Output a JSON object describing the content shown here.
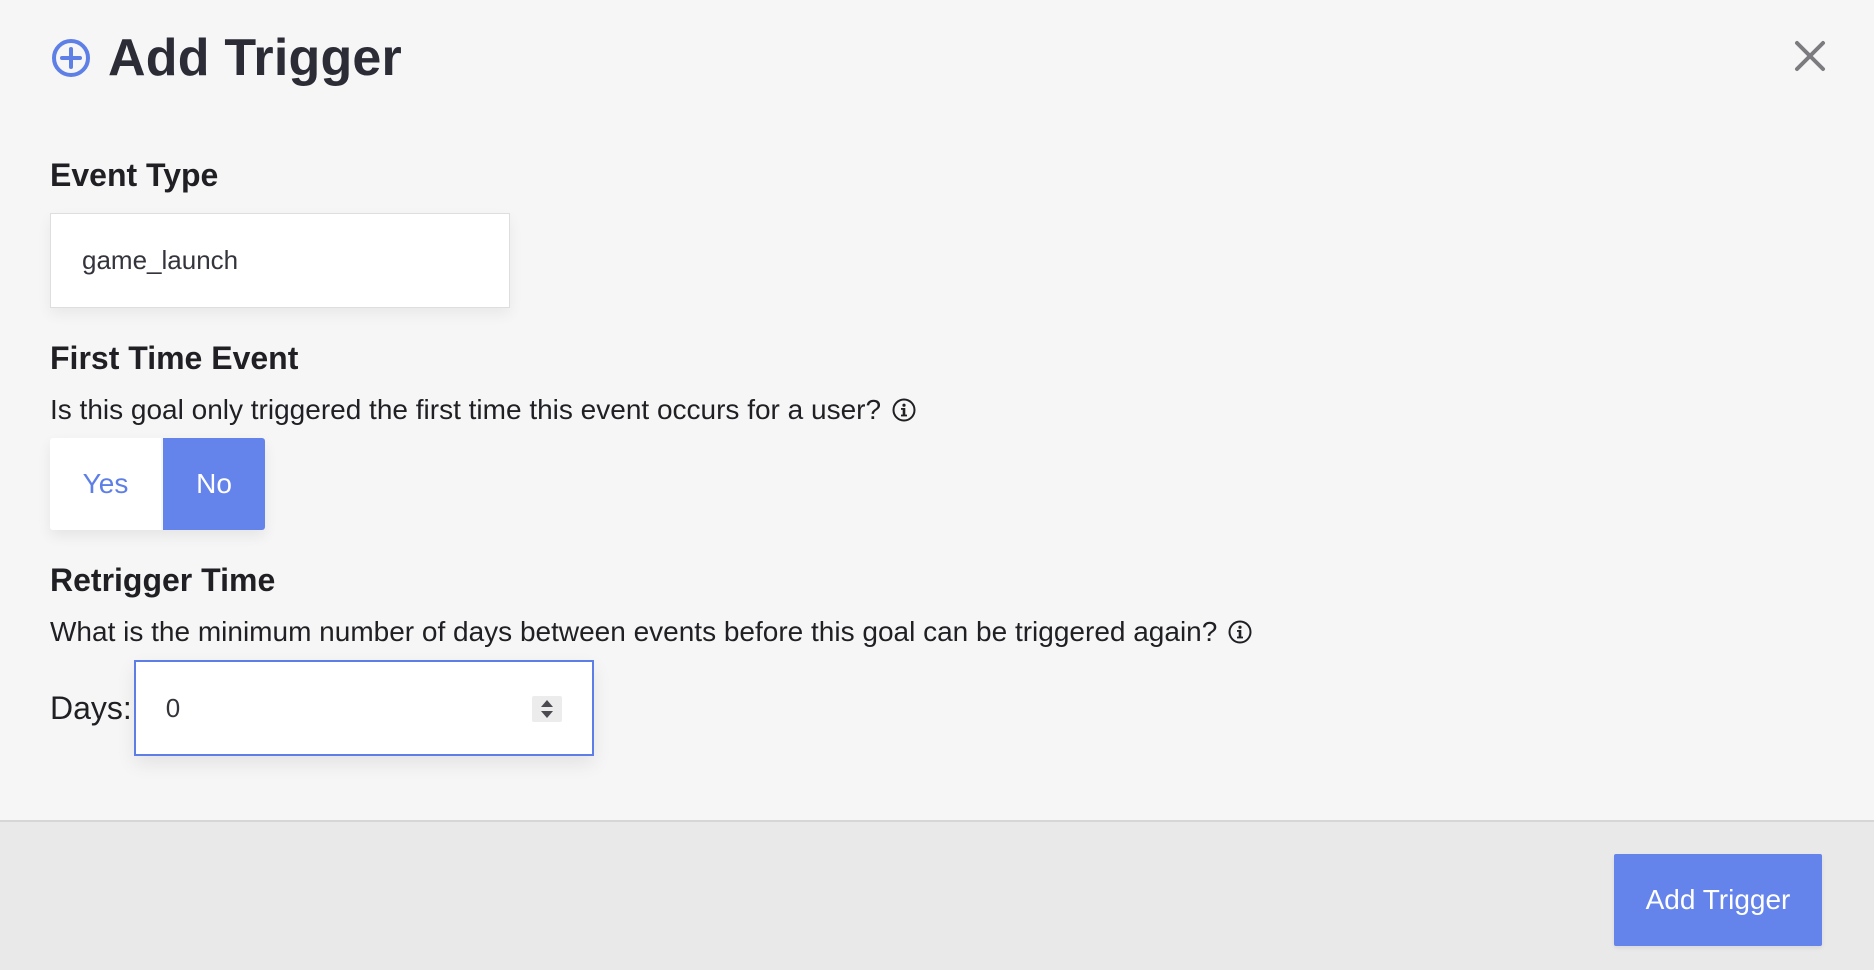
{
  "dialog": {
    "title": "Add Trigger",
    "title_icon": "plus-circle-icon",
    "close_icon": "close-icon",
    "accent_color": "#6484ec"
  },
  "event_type": {
    "label": "Event Type",
    "value": "game_launch"
  },
  "first_time_event": {
    "label": "First Time Event",
    "description": "Is this goal only triggered the first time this event occurs for a user?",
    "info_icon": "info-icon",
    "options": [
      "Yes",
      "No"
    ],
    "selected": "No"
  },
  "retrigger_time": {
    "label": "Retrigger Time",
    "description": "What is the minimum number of days between events before this goal can be triggered again?",
    "info_icon": "info-icon",
    "days_label": "Days:",
    "days_value": "0"
  },
  "footer": {
    "submit_label": "Add Trigger"
  }
}
